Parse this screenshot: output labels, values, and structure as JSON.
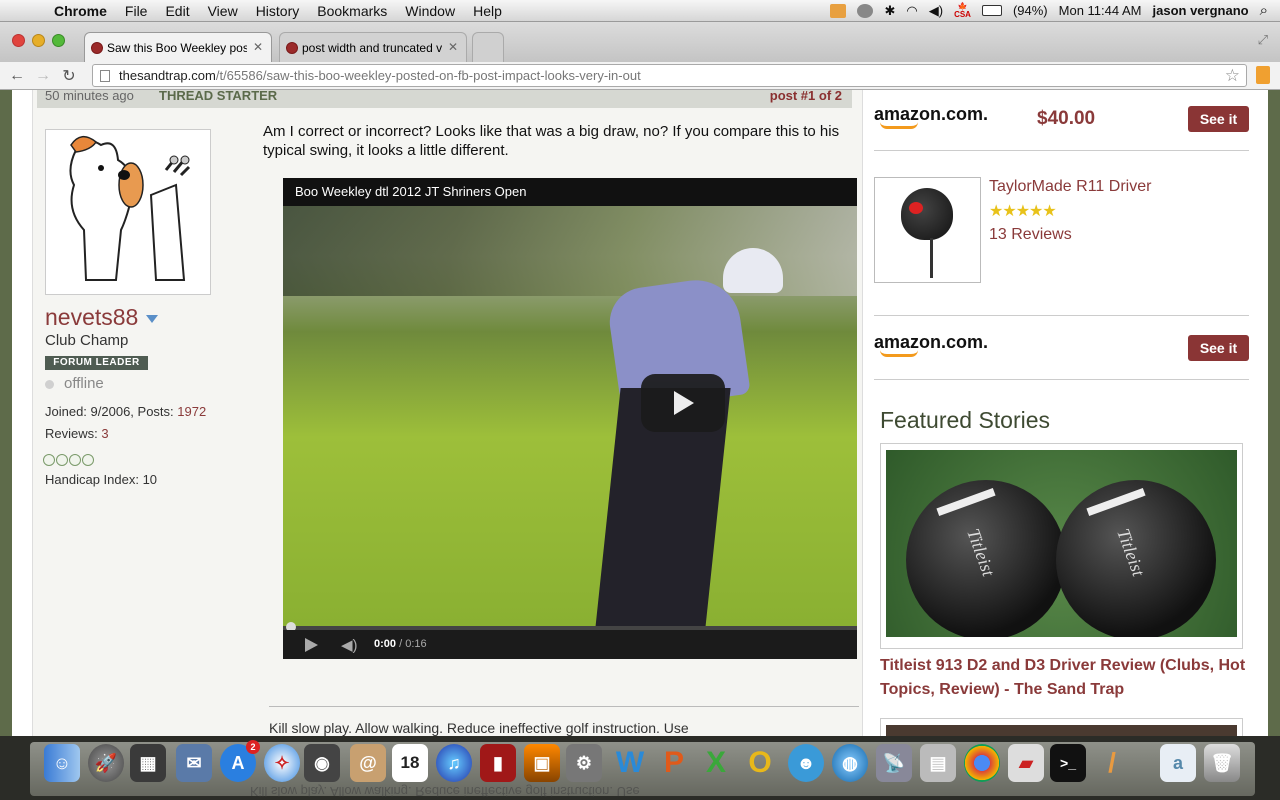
{
  "menubar": {
    "app": "Chrome",
    "menus": [
      "File",
      "Edit",
      "View",
      "History",
      "Bookmarks",
      "Window",
      "Help"
    ],
    "battery": "(94%)",
    "clock": "Mon 11:44 AM",
    "user": "jason vergnano",
    "input_source": "CSA"
  },
  "tabs": [
    {
      "title": "Saw this Boo Weekley post",
      "active": true
    },
    {
      "title": "post width and truncated v",
      "active": false
    }
  ],
  "address": {
    "host": "thesandtrap.com",
    "path": "/t/65586/saw-this-boo-weekley-posted-on-fb-post-impact-looks-very-in-out"
  },
  "post": {
    "time": "50 minutes ago",
    "starter_label": "THREAD STARTER",
    "number": "post #1 of 2",
    "body": "Am I correct or incorrect? Looks like that was a big draw, no? If you compare this to his typical swing, it looks a little different.",
    "signature": "Kill slow play. Allow walking. Reduce ineffective golf instruction. Use"
  },
  "user": {
    "name": "nevets88",
    "rank": "Club Champ",
    "badge": "FORUM LEADER",
    "status": "offline",
    "joined_label": "Joined: 9/2006, Posts: ",
    "posts": "1972",
    "reviews_label": "Reviews: ",
    "reviews": "3",
    "handicap": "Handicap Index: 10"
  },
  "video": {
    "title": "Boo Weekley dtl 2012 JT Shriners Open",
    "current_time": "0:00",
    "separator": " / ",
    "duration": "0:16",
    "progress": 0
  },
  "sidebar": {
    "ad1": {
      "logo": "amazon.com.",
      "price": "$40.00",
      "button": "See it"
    },
    "product": {
      "name": "TaylorMade R11 Driver",
      "rating": 4.5,
      "stars": "★★★★★",
      "reviews": "13 Reviews"
    },
    "ad2": {
      "logo": "amazon.com.",
      "button": "See it"
    },
    "featured_heading": "Featured Stories",
    "story_title": "Titleist 913 D2 and D3 Driver Review (Clubs, Hot Topics, Review) - The Sand Trap",
    "story_image_text": "Titleist"
  },
  "dock": {
    "calendar_day": "18",
    "appstore_badge": "2"
  },
  "colors": {
    "accent": "#8a3a3a",
    "forum_green": "#3e4a32",
    "amazon_orange": "#f39a1c"
  }
}
